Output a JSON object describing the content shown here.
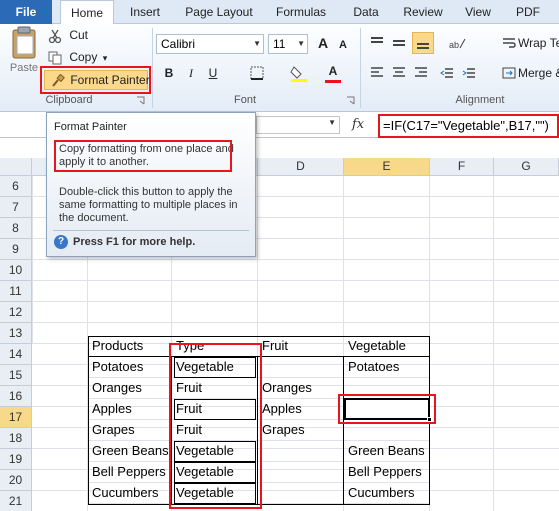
{
  "tabs": [
    "File",
    "Home",
    "Insert",
    "Page Layout",
    "Formulas",
    "Data",
    "Review",
    "View",
    "PDF"
  ],
  "ribbon": {
    "clipboard": {
      "paste": "Paste",
      "cut": "Cut",
      "copy": "Copy",
      "copy_arrow": "▾",
      "format_painter": "Format Painter",
      "group_label": "Clipboard"
    },
    "font": {
      "name": "Calibri",
      "size": "11",
      "grow": "A",
      "shrink": "A",
      "bold": "B",
      "italic": "I",
      "underline": "U",
      "fill": "A",
      "color": "A",
      "group_label": "Font"
    },
    "alignment": {
      "wrap_text": "Wrap Te",
      "merge": "Merge &",
      "group_label": "Alignment"
    }
  },
  "formula_bar": {
    "fx": "fx",
    "formula": "=IF(C17=\"Vegetable\",B17,\"\")"
  },
  "tooltip": {
    "title": "Format Painter",
    "description": "Copy formatting from one place and apply it to another.",
    "detail": "Double-click this button to apply the same formatting to multiple places in the document.",
    "help_icon": "?",
    "help": "Press F1 for more help."
  },
  "columns": [
    "D",
    "E",
    "F",
    "G"
  ],
  "rows": [
    "6",
    "7",
    "8",
    "9",
    "10",
    "11",
    "12",
    "13",
    "14",
    "15",
    "16",
    "17",
    "18",
    "19",
    "20",
    "21"
  ],
  "table": {
    "headers": [
      "Products",
      "Type",
      "Fruit",
      "Vegetable"
    ],
    "rows": [
      [
        "Potatoes",
        "Vegetable",
        "",
        "Potatoes"
      ],
      [
        "Oranges",
        "Fruit",
        "Oranges",
        ""
      ],
      [
        "Apples",
        "Fruit",
        "Apples",
        ""
      ],
      [
        "Grapes",
        "Fruit",
        "Grapes",
        ""
      ],
      [
        "Green Beans",
        "Vegetable",
        "",
        "Green Beans"
      ],
      [
        "Bell Peppers",
        "Vegetable",
        "",
        "Bell Peppers"
      ],
      [
        "Cucumbers",
        "Vegetable",
        "",
        "Cucumbers"
      ]
    ]
  },
  "colors": {
    "highlight": "#e8161c",
    "file_tab": "#2a6ab7",
    "selected_header": "#f8d98a"
  }
}
